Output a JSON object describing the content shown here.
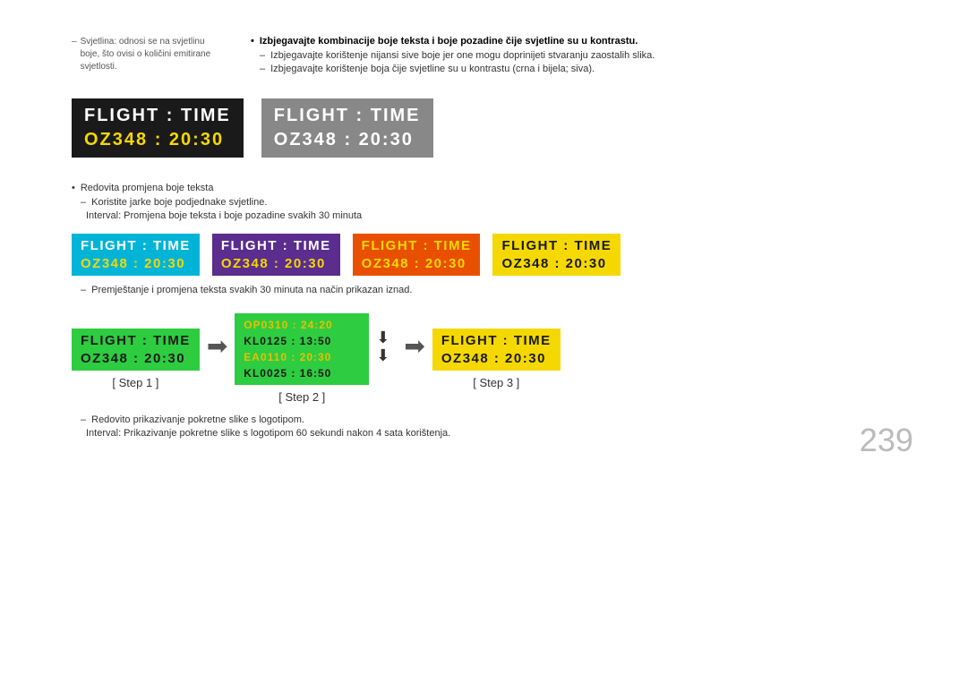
{
  "page": {
    "number": "239"
  },
  "sidenote": {
    "label": "–",
    "text": "Svjetlina: odnosi se na svjetlinu boje, što ovisi o količini emitirane svjetlosti."
  },
  "mainnotes": {
    "bullet1": "•",
    "bullet1_text": "Izbjegavajte kombinacije boje teksta i boje pozadine čije svjetline su u kontrastu.",
    "dash1": "–",
    "dash1_text": "Izbjegavajte korištenje nijansi sive boje jer one mogu doprinijeti stvaranju zaostalih slika.",
    "dash2": "–",
    "dash2_text": "Izbjegavajte korištenje boja čije svjetline su u kontrastu (crna i bijela; siva)."
  },
  "display1": {
    "row1": "FLIGHT  :  TIME",
    "row2": "OZ348   :  20:30"
  },
  "display2": {
    "row1": "FLIGHT  :  TIME",
    "row2": "OZ348   :  20:30"
  },
  "section2_notes": {
    "bullet": "•",
    "bullet_text": "Redovita promjena boje teksta",
    "dash1": "–",
    "dash1_text": "Koristite jarke boje podjednake svjetline.",
    "dash2": "Interval: Promjena boje teksta i boje pozadine svakih 30 minuta"
  },
  "display_cyan": {
    "row1": "FLIGHT  :  TIME",
    "row2": "OZ348   :  20:30"
  },
  "display_purple": {
    "row1": "FLIGHT  :  TIME",
    "row2": "OZ348   :  20:30"
  },
  "display_orange": {
    "row1": "FLIGHT  :  TIME",
    "row2": "OZ348   :  20:30"
  },
  "display_yellow_dark": {
    "row1": "FLIGHT  :  TIME",
    "row2": "OZ348   :  20:30"
  },
  "note_premjestanje": {
    "dash": "–",
    "text": "Premještanje i promjena teksta svakih 30 minuta na način prikazan iznad."
  },
  "step1": {
    "row1": "FLIGHT  :  TIME",
    "row2": "OZ348   :  20:30",
    "label": "[ Step 1 ]"
  },
  "step2": {
    "rows": [
      "OP0310  :  24:20",
      "KL0125  :  13:50",
      "EA0110  :  20:30",
      "KL0025  :  16:50"
    ],
    "label": "[ Step 2 ]"
  },
  "step3": {
    "row1": "FLIGHT  :  TIME",
    "row2": "OZ348   :  20:30",
    "label": "[ Step 3 ]"
  },
  "bottom_notes": {
    "dash": "–",
    "text1": "Redovito prikazivanje pokretne slike s logotipom.",
    "text2": "Interval: Prikazivanje pokretne slike s logotipom 60 sekundi nakon 4 sata korištenja."
  }
}
